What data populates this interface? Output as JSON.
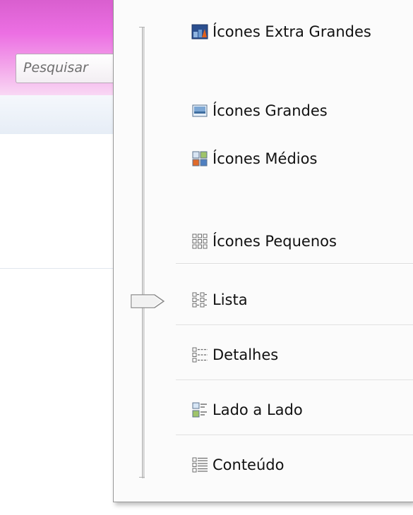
{
  "background_window": {
    "search_placeholder": "Pesquisar"
  },
  "view_menu": {
    "items": [
      {
        "label": "Ícones Extra Grandes",
        "icon": "extra-large-icons-icon"
      },
      {
        "label": "Ícones Grandes",
        "icon": "large-icons-icon"
      },
      {
        "label": "Ícones Médios",
        "icon": "medium-icons-icon"
      },
      {
        "label": "Ícones Pequenos",
        "icon": "small-icons-icon"
      },
      {
        "label": "Lista",
        "icon": "list-icon"
      },
      {
        "label": "Detalhes",
        "icon": "details-icon"
      },
      {
        "label": "Lado a Lado",
        "icon": "tiles-icon"
      },
      {
        "label": "Conteúdo",
        "icon": "content-icon"
      }
    ],
    "selected": "Lista"
  }
}
